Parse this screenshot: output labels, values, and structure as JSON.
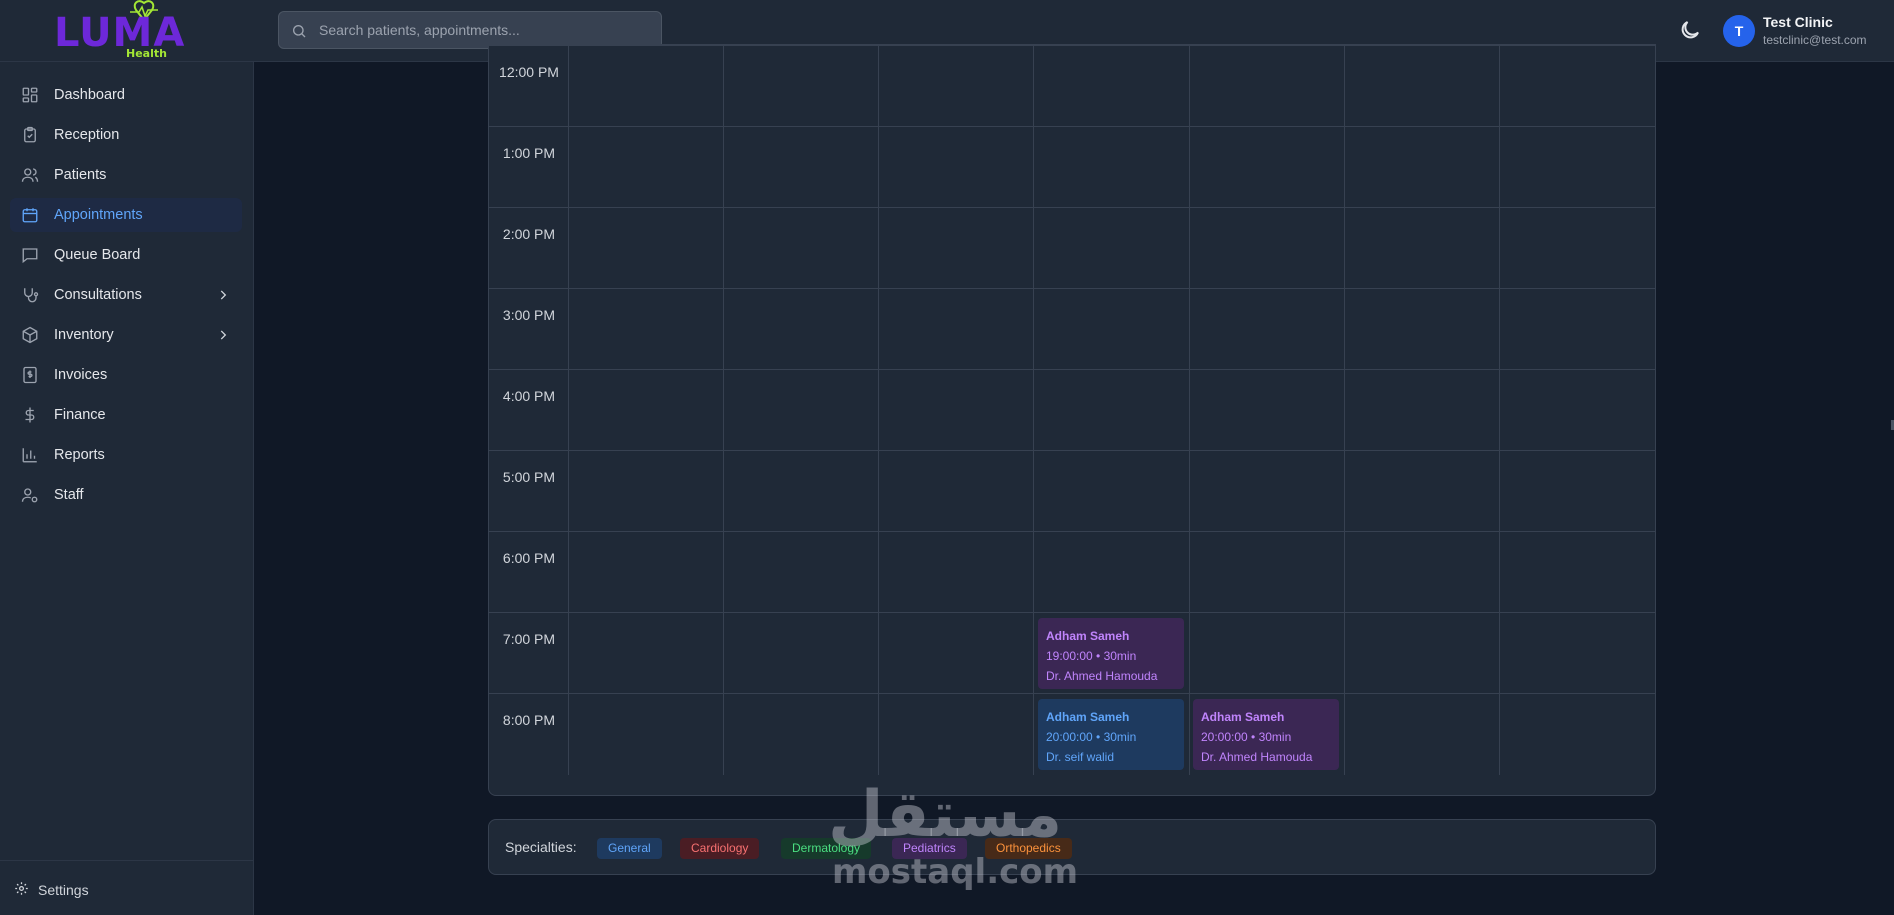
{
  "brand": {
    "name": "LUMA",
    "tagline": "Health"
  },
  "search": {
    "placeholder": "Search patients, appointments..."
  },
  "user": {
    "initial": "T",
    "name": "Test Clinic",
    "email": "testclinic@test.com"
  },
  "sidebar": {
    "items": [
      {
        "label": "Dashboard",
        "icon": "layout-grid-icon"
      },
      {
        "label": "Reception",
        "icon": "clipboard-check-icon"
      },
      {
        "label": "Patients",
        "icon": "users-icon"
      },
      {
        "label": "Appointments",
        "icon": "calendar-icon",
        "active": true
      },
      {
        "label": "Queue Board",
        "icon": "message-square-icon"
      },
      {
        "label": "Consultations",
        "icon": "stethoscope-icon",
        "expandable": true
      },
      {
        "label": "Inventory",
        "icon": "box-icon",
        "expandable": true
      },
      {
        "label": "Invoices",
        "icon": "receipt-icon"
      },
      {
        "label": "Finance",
        "icon": "dollar-icon"
      },
      {
        "label": "Reports",
        "icon": "bar-chart-icon"
      },
      {
        "label": "Staff",
        "icon": "user-cog-icon"
      }
    ],
    "settings_label": "Settings"
  },
  "calendar": {
    "times": [
      "12:00 PM",
      "1:00 PM",
      "2:00 PM",
      "3:00 PM",
      "4:00 PM",
      "5:00 PM",
      "6:00 PM",
      "7:00 PM",
      "8:00 PM"
    ],
    "appointments": [
      {
        "patient": "Adham Sameh",
        "time": "19:00:00 • 30min",
        "doctor": "Dr. Ahmed Hamouda",
        "color": "purple"
      },
      {
        "patient": "Adham Sameh",
        "time": "20:00:00 • 30min",
        "doctor": "Dr. seif walid",
        "color": "blue"
      },
      {
        "patient": "Adham Sameh",
        "time": "20:00:00 • 30min",
        "doctor": "Dr. Ahmed Hamouda",
        "color": "purple"
      }
    ]
  },
  "legend": {
    "title": "Specialties:",
    "items": [
      "General",
      "Cardiology",
      "Dermatology",
      "Pediatrics",
      "Orthopedics"
    ]
  },
  "watermark": {
    "arabic": "مستقل",
    "latin": "mostaql.com"
  },
  "colors": {
    "accent": "#60a5fa",
    "brand": "#6d28d9",
    "brand_secondary": "#a3e635",
    "appt_purple": "#c084fc",
    "appt_blue": "#60a5fa"
  }
}
